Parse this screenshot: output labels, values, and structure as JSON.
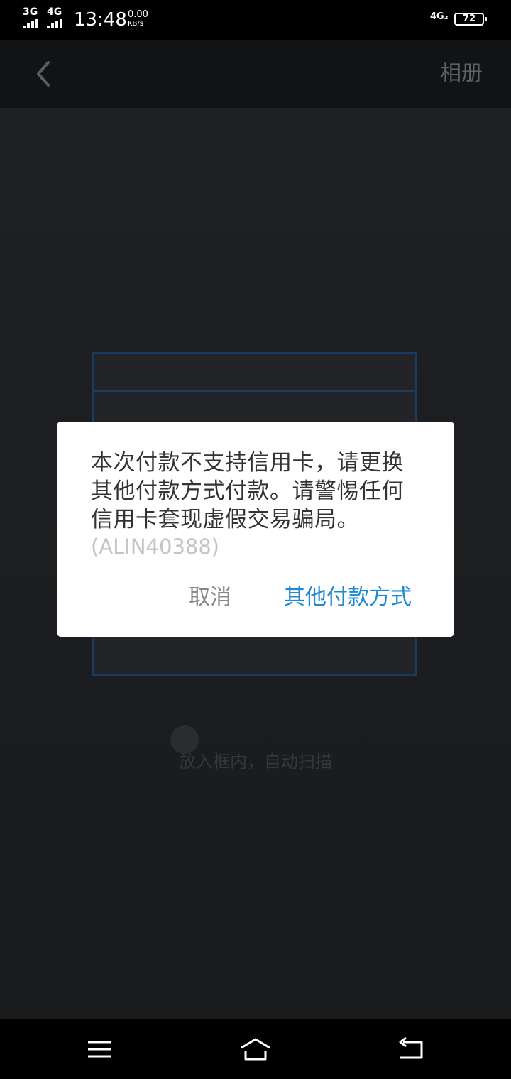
{
  "status_bar": {
    "sim1_network": "3G",
    "sim2_network": "4G",
    "time": "13:48",
    "speed_value": "0.00",
    "speed_unit": "KB/s",
    "right_network": "4G₂",
    "battery_level": "72"
  },
  "nav": {
    "back_icon": "chevron-left-icon",
    "album_label": "相册"
  },
  "scanner": {
    "hint": "放入框内，自动扫描"
  },
  "dialog": {
    "message": "本次付款不支持信用卡，请更换其他付款方式付款。请警惕任何信用卡套现虚假交易骗局。",
    "error_code": "(ALIN40388)",
    "cancel_label": "取消",
    "other_payment_label": "其他付款方式"
  },
  "system_nav": {
    "menu_icon": "menu-icon",
    "home_icon": "home-icon",
    "back_icon": "return-icon"
  },
  "colors": {
    "accent": "#1e88d0",
    "dialog_bg": "#ffffff",
    "overlay_bg": "#1b1d20"
  }
}
